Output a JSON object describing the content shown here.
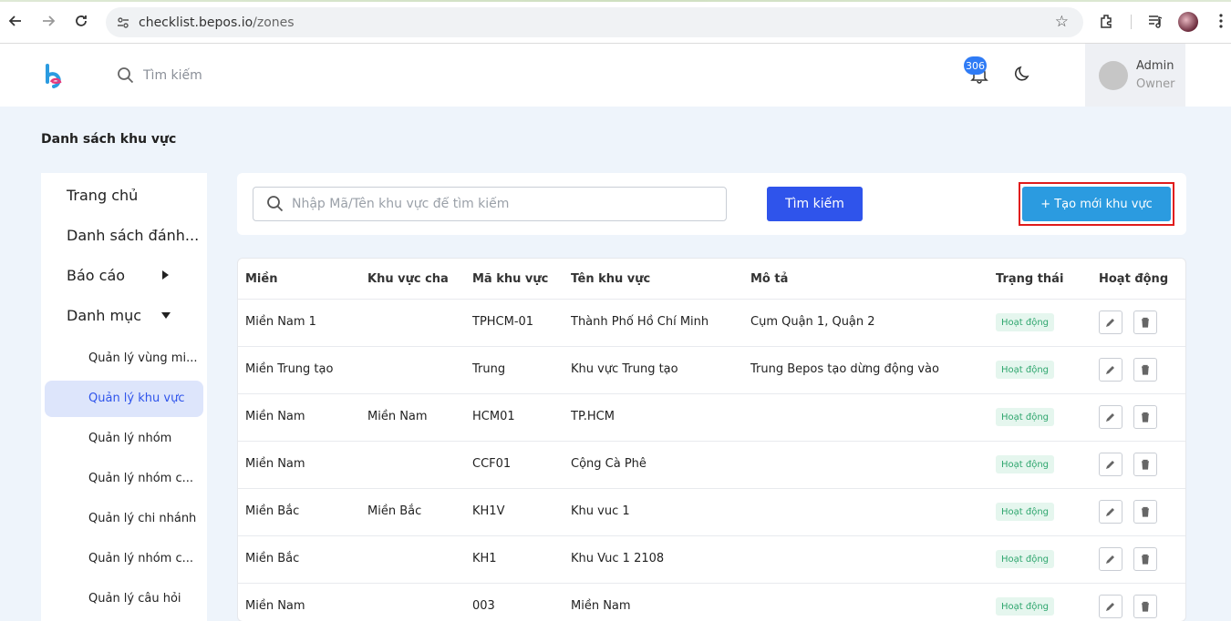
{
  "browser": {
    "url_host": "checklist.bepos.io",
    "url_path": "/zones"
  },
  "header": {
    "search_placeholder": "Tìm kiếm",
    "notification_count": "306",
    "user_name": "Admin",
    "user_role": "Owner"
  },
  "page_title": "Danh sách khu vực",
  "sidebar": {
    "items": [
      {
        "label": "Trang chủ"
      },
      {
        "label": "Danh sách đánh..."
      },
      {
        "label": "Báo cáo"
      },
      {
        "label": "Danh mục"
      }
    ],
    "sub_items": [
      {
        "label": "Quản lý vùng mi..."
      },
      {
        "label": "Quản lý khu vực"
      },
      {
        "label": "Quản lý nhóm"
      },
      {
        "label": "Quản lý nhóm c..."
      },
      {
        "label": "Quản lý chi nhánh"
      },
      {
        "label": "Quản lý nhóm c..."
      },
      {
        "label": "Quản lý câu hỏi"
      }
    ]
  },
  "toolbar": {
    "search_placeholder": "Nhập Mã/Tên khu vực để tìm kiếm",
    "search_button": "Tìm kiếm",
    "create_button": "+ Tạo mới khu vực"
  },
  "table": {
    "columns": [
      "Miền",
      "Khu vực cha",
      "Mã khu vực",
      "Tên khu vực",
      "Mô tả",
      "Trạng thái",
      "Hoạt động"
    ],
    "rows": [
      {
        "mien": "Miền Nam 1",
        "parent": "",
        "code": "TPHCM-01",
        "name": "Thành Phố Hồ Chí Minh",
        "desc": "Cụm Quận 1, Quận 2",
        "status": "Hoạt động"
      },
      {
        "mien": "Miền Trung tạo",
        "parent": "",
        "code": "Trung",
        "name": "Khu vực Trung tạo",
        "desc": "Trung Bepos tạo dừng động vào",
        "status": "Hoạt động"
      },
      {
        "mien": "Miền Nam",
        "parent": "Miền Nam",
        "code": "HCM01",
        "name": "TP.HCM",
        "desc": "",
        "status": "Hoạt động"
      },
      {
        "mien": "Miền Nam",
        "parent": "",
        "code": "CCF01",
        "name": "Cộng Cà Phê",
        "desc": "",
        "status": "Hoạt động"
      },
      {
        "mien": "Miền Bắc",
        "parent": "Miền Bắc",
        "code": "KH1V",
        "name": "Khu vuc 1",
        "desc": "",
        "status": "Hoạt động"
      },
      {
        "mien": "Miền Bắc",
        "parent": "",
        "code": "KH1",
        "name": "Khu Vuc 1 2108",
        "desc": "",
        "status": "Hoạt động"
      },
      {
        "mien": "Miền Nam",
        "parent": "",
        "code": "003",
        "name": "Miền Nam",
        "desc": "",
        "status": "Hoạt động"
      }
    ]
  },
  "colors": {
    "primary_button": "#2f54eb",
    "create_button": "#2b9be0",
    "highlight_outline": "#e01b1b",
    "status_bg": "#e5f6ee",
    "status_text": "#2fa66e"
  }
}
